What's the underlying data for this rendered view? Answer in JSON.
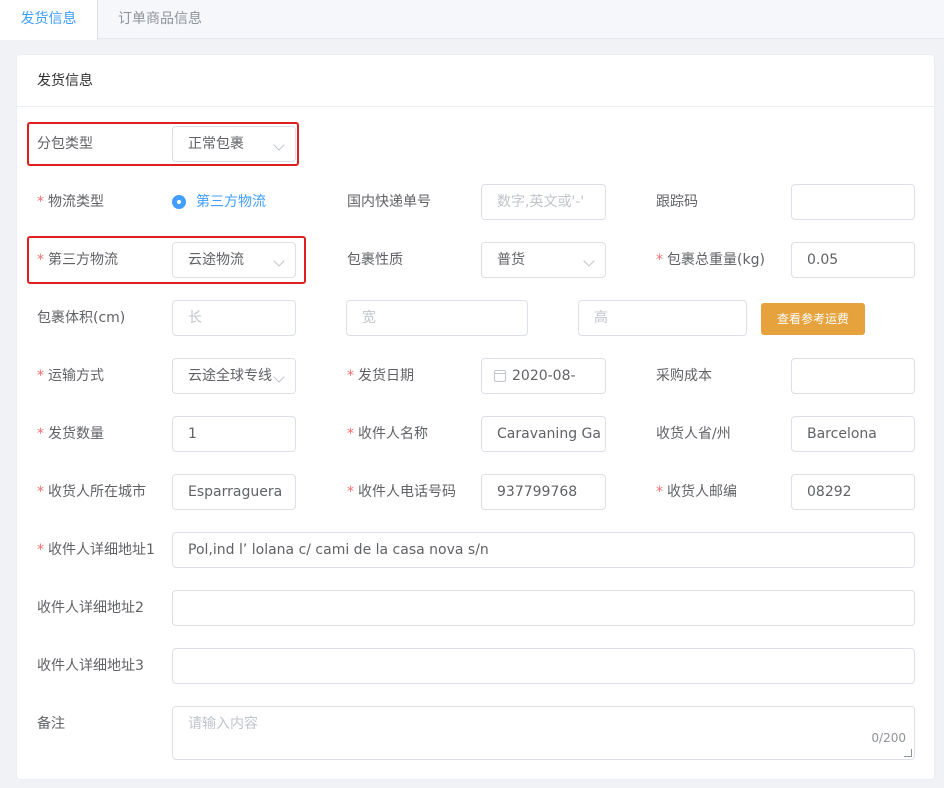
{
  "tabs": [
    {
      "label": "发货信息",
      "active": true
    },
    {
      "label": "订单商品信息",
      "active": false
    }
  ],
  "card": {
    "title": "发货信息"
  },
  "form": {
    "package_type": {
      "label": "分包类型",
      "value": "正常包裹"
    },
    "logistics_type": {
      "label": "物流类型",
      "option": "第三方物流"
    },
    "domestic_tracking": {
      "label": "国内快递单号",
      "placeholder": "数字,英文或'-'"
    },
    "tracking_code": {
      "label": "跟踪码",
      "value": ""
    },
    "third_party": {
      "label": "第三方物流",
      "value": "云途物流"
    },
    "package_nature": {
      "label": "包裹性质",
      "value": "普货"
    },
    "total_weight": {
      "label": "包裹总重量(kg)",
      "value": "0.05"
    },
    "volume": {
      "label": "包裹体积(cm)",
      "length_ph": "长",
      "width_ph": "宽",
      "height_ph": "高"
    },
    "freight_button": "查看参考运费",
    "shipping_method": {
      "label": "运输方式",
      "value": "云途全球专线"
    },
    "ship_date": {
      "label": "发货日期",
      "value": "2020-08-"
    },
    "purchase_cost": {
      "label": "采购成本",
      "value": ""
    },
    "ship_qty": {
      "label": "发货数量",
      "value": "1"
    },
    "recipient_name": {
      "label": "收件人名称",
      "value": "Caravaning Ga"
    },
    "recipient_state": {
      "label": "收货人省/州",
      "value": "Barcelona"
    },
    "recipient_city": {
      "label": "收货人所在城市",
      "value": "Esparraguera"
    },
    "recipient_phone": {
      "label": "收件人电话号码",
      "value": "937799768"
    },
    "recipient_zip": {
      "label": "收货人邮编",
      "value": "08292"
    },
    "address1": {
      "label": "收件人详细地址1",
      "value": "Pol,ind l’ lolana c/ cami de la casa nova s/n"
    },
    "address2": {
      "label": "收件人详细地址2",
      "value": ""
    },
    "address3": {
      "label": "收件人详细地址3",
      "value": ""
    },
    "remark": {
      "label": "备注",
      "placeholder": "请输入内容",
      "counter": "0/200"
    }
  },
  "colors": {
    "primary": "#409eff",
    "warning": "#e6a23c",
    "required": "#f56c6c",
    "highlight": "#e02020"
  }
}
